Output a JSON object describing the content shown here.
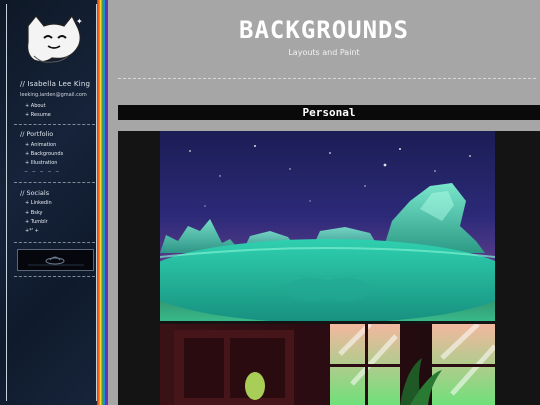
{
  "sidebar": {
    "name": "// Isabella Lee King",
    "email": "leeking.iarden@gmail.com",
    "about_links": [
      "+ About",
      "+ Resume"
    ],
    "portfolio_heading": "// Portfolio",
    "portfolio_links": [
      "+ Animation",
      "+ Backgrounds",
      "+ Illustration"
    ],
    "socials_heading": "// Socials",
    "social_links": [
      "+ Linkedin",
      "+ Bsky",
      "+ Tumblr",
      "+*' +"
    ]
  },
  "header": {
    "title": "BACKGROUNDS",
    "subtitle": "Layouts and Paint"
  },
  "section": {
    "title": "Personal"
  },
  "colors": {
    "main_bg": "#a6a6a6",
    "sidebar_bg": "#16233a",
    "section_bar": "#0a0a0a",
    "gallery_bg": "#141414"
  },
  "icons": [
    "cat-logo-icon",
    "paw-print-icon",
    "ufo-icon"
  ]
}
